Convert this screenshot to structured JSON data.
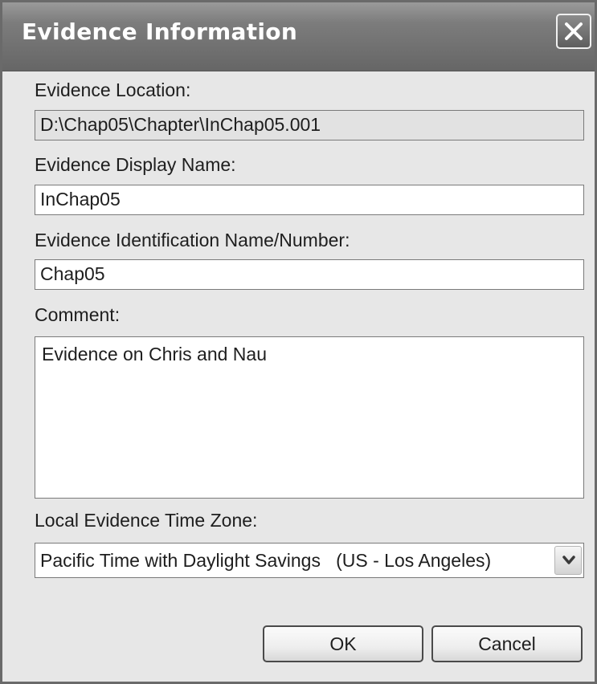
{
  "window": {
    "title": "Evidence Information"
  },
  "evidence_location": {
    "label": "Evidence Location:",
    "value": "D:\\Chap05\\Chapter\\InChap05.001"
  },
  "display_name": {
    "label": "Evidence Display Name:",
    "value": "InChap05"
  },
  "identification": {
    "label": "Evidence Identification Name/Number:",
    "value": "Chap05"
  },
  "comment": {
    "label": "Comment:",
    "value": "Evidence on Chris and Nau"
  },
  "time_zone": {
    "label": "Local Evidence Time Zone:",
    "selected": "Pacific Time with Daylight Savings   (US - Los Angeles)"
  },
  "buttons": {
    "ok": "OK",
    "cancel": "Cancel"
  },
  "icons": {
    "close": "close-icon",
    "dropdown": "chevron-down-icon"
  }
}
